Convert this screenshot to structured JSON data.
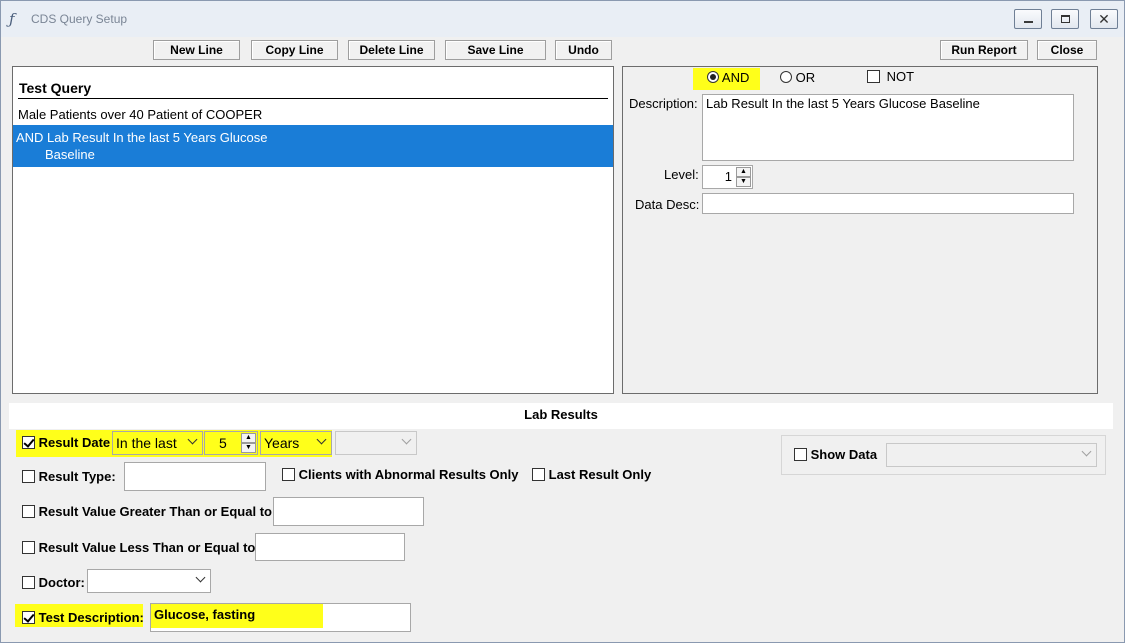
{
  "window": {
    "title": "CDS Query Setup",
    "close_glyph": "✕"
  },
  "toolbar": {
    "new_line": "New Line",
    "copy_line": "Copy Line",
    "delete_line": "Delete Line",
    "save_line": "Save Line",
    "undo": "Undo",
    "run_report": "Run Report",
    "close": "Close"
  },
  "query": {
    "header": "Test Query",
    "rows": [
      {
        "line1": "Male Patients over 40 Patient of COOPER"
      },
      {
        "line1": "AND Lab Result  In the last 5 Years  Glucose",
        "line2": "Baseline",
        "selected": true
      }
    ]
  },
  "detail": {
    "logic": {
      "and": "AND",
      "or": "OR",
      "not": "NOT",
      "selected": "AND",
      "not_checked": false
    },
    "description_label": "Description:",
    "description_value": "Lab Result  In the last 5 Years  Glucose Baseline",
    "level_label": "Level:",
    "level_value": "1",
    "data_desc_label": "Data Desc:",
    "data_desc_value": ""
  },
  "lab_results": {
    "section_title": "Lab Results",
    "result_date": {
      "label": "Result Date",
      "checked": true,
      "mode": "In the last",
      "amount": "5",
      "unit": "Years",
      "extra": ""
    },
    "result_type": {
      "label": "Result Type:",
      "checked": false,
      "value": ""
    },
    "abnormal_only": {
      "label": "Clients with Abnormal Results Only",
      "checked": false
    },
    "last_only": {
      "label": "Last Result Only",
      "checked": false
    },
    "value_gte": {
      "label": "Result Value Greater Than or Equal to:",
      "checked": false,
      "value": ""
    },
    "value_lte": {
      "label": "Result Value Less Than or Equal to:",
      "checked": false,
      "value": ""
    },
    "doctor": {
      "label": "Doctor:",
      "checked": false,
      "value": ""
    },
    "test_description": {
      "label": "Test Description:",
      "checked": true,
      "value": "Glucose, fasting"
    },
    "show_data": {
      "label": "Show Data",
      "checked": false,
      "value": ""
    }
  },
  "colors": {
    "highlight": "#ffff1a",
    "selection": "#1a7dd7"
  }
}
